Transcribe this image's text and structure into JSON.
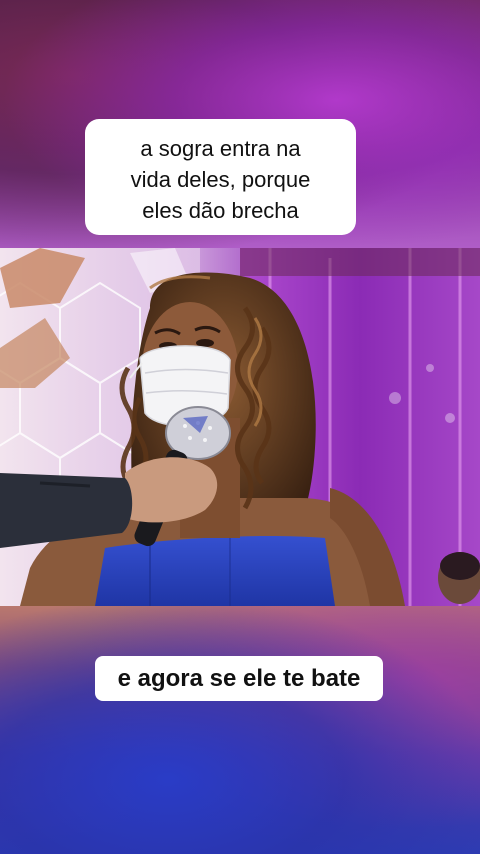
{
  "captions": {
    "top_lines": [
      "a sogra entra na",
      "vida deles, porque",
      "eles dão brecha"
    ],
    "bottom": "e agora se ele te bate"
  },
  "colors": {
    "caption_bg": "#ffffff",
    "caption_text": "#111111",
    "dress": "#2740b8",
    "stage_purple": "#9a3fbf"
  },
  "video": {
    "scene": "woman-with-face-mask-holding-microphone"
  }
}
